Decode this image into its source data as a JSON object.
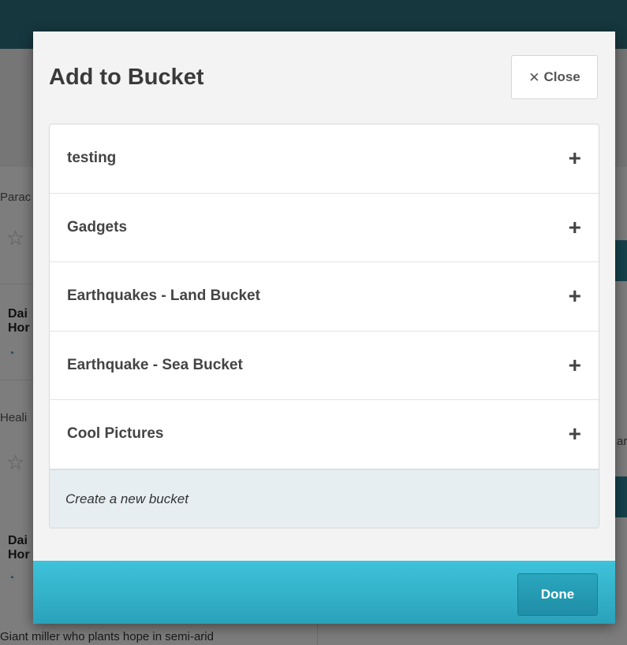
{
  "background": {
    "snippets": [
      "Parac",
      "Heali",
      "Dai",
      "Hor",
      "Dai",
      "Hor",
      "ar",
      "Giant miller who plants hope in semi-arid"
    ]
  },
  "modal": {
    "title": "Add to Bucket",
    "close_label": "Close",
    "buckets": [
      {
        "name": "testing"
      },
      {
        "name": "Gadgets"
      },
      {
        "name": "Earthquakes - Land Bucket"
      },
      {
        "name": "Earthquake - Sea Bucket"
      },
      {
        "name": "Cool Pictures"
      }
    ],
    "new_bucket_placeholder": "Create a new bucket",
    "done_label": "Done"
  },
  "icons": {
    "close": "close-icon",
    "add": "plus-icon",
    "favorite": "star-icon",
    "feed": "rss-icon"
  }
}
